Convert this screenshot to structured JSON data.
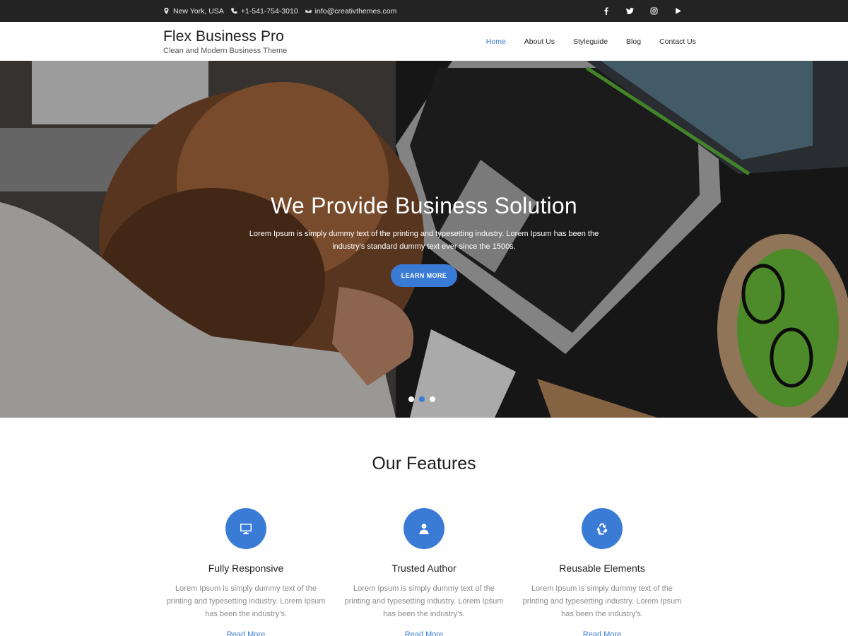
{
  "topbar": {
    "location": "New York, USA",
    "phone": "+1-541-754-3010",
    "email": "info@creativthemes.com",
    "social": [
      "facebook-icon",
      "twitter-icon",
      "instagram-icon",
      "youtube-icon"
    ]
  },
  "header": {
    "site_title": "Flex Business Pro",
    "tagline": "Clean and Modern Business Theme",
    "nav": [
      {
        "label": "Home",
        "active": true
      },
      {
        "label": "About Us",
        "active": false
      },
      {
        "label": "Styleguide",
        "active": false
      },
      {
        "label": "Blog",
        "active": false
      },
      {
        "label": "Contact Us",
        "active": false
      }
    ]
  },
  "hero": {
    "heading": "We Provide Business Solution",
    "subtext": "Lorem Ipsum is simply dummy text of the printing and typesetting industry. Lorem Ipsum has been the industry's standard dummy text ever since the 1500s.",
    "button": "LEARN MORE",
    "slides": 3,
    "active_slide": 2
  },
  "features": {
    "title": "Our Features",
    "items": [
      {
        "icon": "monitor-icon",
        "title": "Fully Responsive",
        "text": "Lorem Ipsum is simply dummy text of the printing and typesetting industry. Lorem Ipsum has been the industry's.",
        "link": "Read More"
      },
      {
        "icon": "user-icon",
        "title": "Trusted Author",
        "text": "Lorem Ipsum is simply dummy text of the printing and typesetting industry. Lorem Ipsum has been the industry's.",
        "link": "Read More"
      },
      {
        "icon": "recycle-icon",
        "title": "Reusable Elements",
        "text": "Lorem Ipsum is simply dummy text of the printing and typesetting industry. Lorem Ipsum has been the industry's.",
        "link": "Read More"
      }
    ]
  },
  "colors": {
    "accent": "#3a7bd5",
    "topbar_bg": "#232323"
  }
}
